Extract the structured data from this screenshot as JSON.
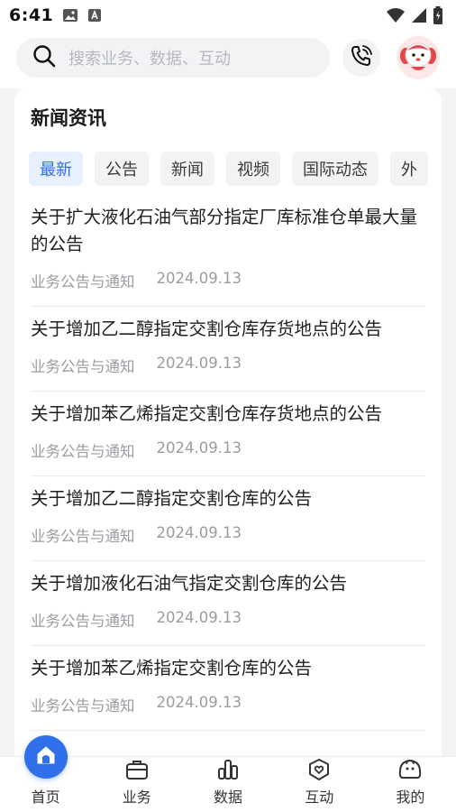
{
  "status_bar": {
    "time": "6:41",
    "icons": [
      "image-icon",
      "font-icon",
      "wifi-icon",
      "signal-icon",
      "battery-icon"
    ]
  },
  "search": {
    "placeholder": "搜索业务、数据、互动",
    "icon": "search-icon"
  },
  "header": {
    "phone_icon": "phone-call-icon",
    "avatar_icon": "mascot-avatar"
  },
  "news": {
    "title": "新闻资讯",
    "tabs": [
      {
        "label": "最新",
        "active": true
      },
      {
        "label": "公告",
        "active": false
      },
      {
        "label": "新闻",
        "active": false
      },
      {
        "label": "视频",
        "active": false
      },
      {
        "label": "国际动态",
        "active": false
      },
      {
        "label": "外",
        "active": false
      }
    ],
    "items": [
      {
        "title": "关于扩大液化石油气部分指定厂库标准仓单最大量的公告",
        "category": "业务公告与通知",
        "date": "2024.09.13"
      },
      {
        "title": "关于增加乙二醇指定交割仓库存货地点的公告",
        "category": "业务公告与通知",
        "date": "2024.09.13"
      },
      {
        "title": "关于增加苯乙烯指定交割仓库存货地点的公告",
        "category": "业务公告与通知",
        "date": "2024.09.13"
      },
      {
        "title": "关于增加乙二醇指定交割仓库的公告",
        "category": "业务公告与通知",
        "date": "2024.09.13"
      },
      {
        "title": "关于增加液化石油气指定交割仓库的公告",
        "category": "业务公告与通知",
        "date": "2024.09.13"
      },
      {
        "title": "关于增加苯乙烯指定交割仓库的公告",
        "category": "业务公告与通知",
        "date": "2024.09.13"
      }
    ]
  },
  "bottom_nav": {
    "items": [
      {
        "label": "首页",
        "icon": "home-icon",
        "active": true
      },
      {
        "label": "业务",
        "icon": "briefcase-icon",
        "active": false
      },
      {
        "label": "数据",
        "icon": "bar-chart-icon",
        "active": false
      },
      {
        "label": "互动",
        "icon": "heart-chat-icon",
        "active": false
      },
      {
        "label": "我的",
        "icon": "profile-icon",
        "active": false
      }
    ]
  },
  "colors": {
    "accent": "#2f6fea",
    "active_tab_bg": "#e8f0ff",
    "meta_text": "#9a9ca1",
    "page_bg": "#f3f4f6"
  }
}
